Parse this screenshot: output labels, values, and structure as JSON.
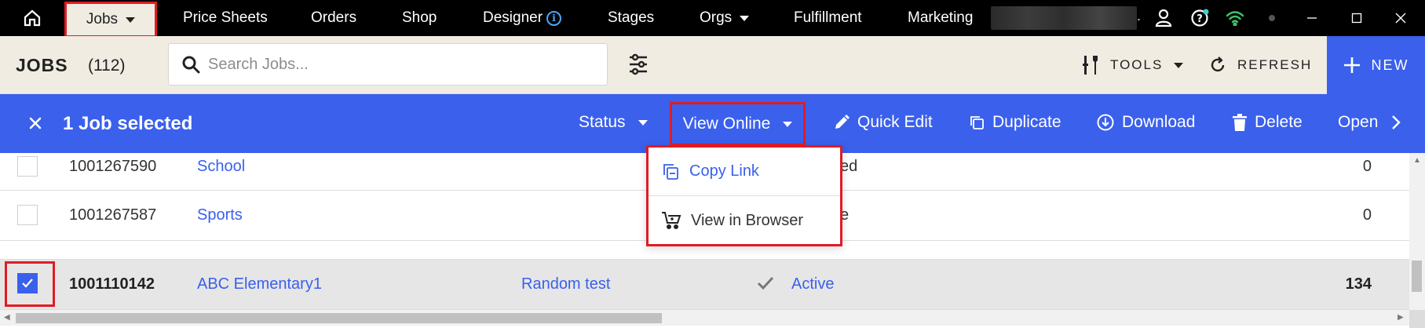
{
  "topnav": {
    "items": [
      {
        "label": "Jobs",
        "has_caret": true,
        "active": true
      },
      {
        "label": "Price Sheets"
      },
      {
        "label": "Orders"
      },
      {
        "label": "Shop"
      },
      {
        "label": "Designer",
        "info": "i"
      },
      {
        "label": "Stages"
      },
      {
        "label": "Orgs",
        "has_caret": true
      },
      {
        "label": "Fulfillment"
      },
      {
        "label": "Marketing"
      }
    ],
    "trailing_dot": "."
  },
  "toolbar": {
    "title": "JOBS",
    "count": "(112)",
    "search_placeholder": "Search Jobs...",
    "tools_label": "TOOLS",
    "refresh_label": "REFRESH",
    "new_label": "NEW"
  },
  "selection_bar": {
    "selected_text": "1 Job selected",
    "status_label": "Status",
    "view_online_label": "View Online",
    "quick_edit_label": "Quick Edit",
    "duplicate_label": "Duplicate",
    "download_label": "Download",
    "delete_label": "Delete",
    "open_label": "Open"
  },
  "dropdown": {
    "items": [
      "Copy Link",
      "View in Browser"
    ]
  },
  "table": {
    "rows": [
      {
        "id": "1001267590",
        "name": "School",
        "partial_status": "ed",
        "count": "0",
        "checked": false
      },
      {
        "id": "1001267587",
        "name": "Sports",
        "partial_status": "e",
        "count": "0",
        "checked": false
      },
      {
        "id": "1001110142",
        "name": "ABC Elementary1",
        "org": "Random test",
        "status": "Active",
        "count": "134",
        "checked": true
      }
    ]
  },
  "colors": {
    "accent": "#3a60ec",
    "highlight": "#e01b24",
    "toolbar_bg": "#f0ece2"
  }
}
